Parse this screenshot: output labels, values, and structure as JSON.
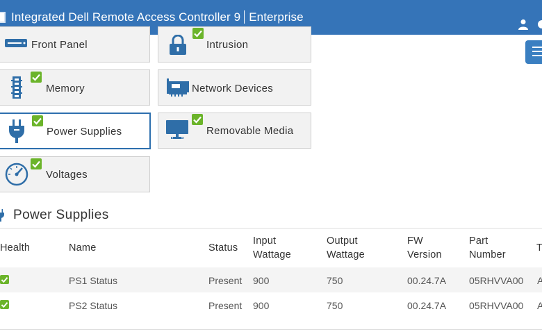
{
  "header": {
    "title": "Integrated Dell Remote Access Controller 9",
    "edition": "Enterprise"
  },
  "tiles": [
    {
      "label": "Front Panel",
      "status": "ok",
      "icon": "front-panel-icon"
    },
    {
      "label": "Intrusion",
      "status": "ok",
      "icon": "lock-icon"
    },
    {
      "label": "Memory",
      "status": "ok",
      "icon": "memory-icon"
    },
    {
      "label": "Network Devices",
      "status": "none",
      "icon": "network-card-icon"
    },
    {
      "label": "Power Supplies",
      "status": "ok",
      "icon": "power-plug-icon",
      "selected": true
    },
    {
      "label": "Removable Media",
      "status": "ok",
      "icon": "monitor-icon"
    },
    {
      "label": "Voltages",
      "status": "ok",
      "icon": "gauge-icon"
    }
  ],
  "section": {
    "title": "Power Supplies"
  },
  "table": {
    "headers": {
      "health": "Health",
      "name": "Name",
      "status": "Status",
      "input_1": "Input",
      "input_2": "Wattage",
      "output_1": "Output",
      "output_2": "Wattage",
      "fw_1": "FW",
      "fw_2": "Version",
      "part_1": "Part",
      "part_2": "Number",
      "extra": "T"
    },
    "rows": [
      {
        "health": "ok",
        "name": "PS1 Status",
        "status": "Present",
        "input": "900",
        "output": "750",
        "fw": "00.24.7A",
        "part": "05RHVVA00",
        "extra": "A"
      },
      {
        "health": "ok",
        "name": "PS2 Status",
        "status": "Present",
        "input": "900",
        "output": "750",
        "fw": "00.24.7A",
        "part": "05RHVVA00",
        "extra": "A"
      }
    ]
  },
  "colors": {
    "header_bg": "#3574b8",
    "accent": "#2d6fae",
    "ok_green": "#6bb42a",
    "icon_blue": "#2f6ea8"
  }
}
